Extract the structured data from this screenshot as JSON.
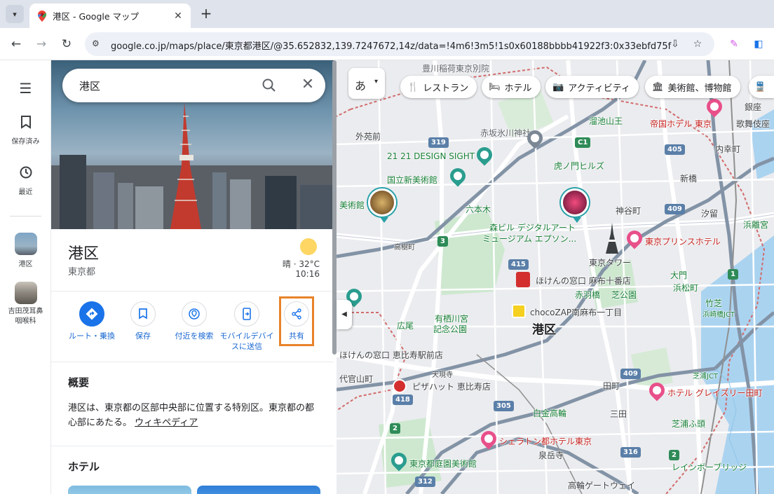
{
  "browser": {
    "tab_title": "港区 - Google マップ",
    "url": "google.co.jp/maps/place/東京都港区/@35.652832,139.7247672,14z/data=!4m6!3m5!1s0x60188bbbb41922f3:0x33ebfd75f2f0..."
  },
  "rail": {
    "saved": "保存済み",
    "recent": "最近",
    "place1": "港区",
    "place2": "吉田茂耳鼻咽喉科"
  },
  "search": {
    "query": "港区"
  },
  "place": {
    "name": "港区",
    "region": "東京都",
    "weather": "晴 · 32°C",
    "time": "10:16"
  },
  "actions": [
    {
      "label": "ルート・乗換"
    },
    {
      "label": "保存"
    },
    {
      "label": "付近を検索"
    },
    {
      "label": "モバイルデバイスに送信"
    },
    {
      "label": "共有"
    }
  ],
  "overview": {
    "heading": "概要",
    "text": "港区は、東京都の区部中央部に位置する特別区。東京都の都心部にあたる。",
    "link": "ウィキペディア"
  },
  "hotels": {
    "heading": "ホテル"
  },
  "map": {
    "lang_button": "あ",
    "chips": [
      "レストラン",
      "ホテル",
      "アクティビティ",
      "美術館、博物館"
    ],
    "labels": {
      "toyokawa": "豊川稲荷東京別院",
      "akasaka": "赤坂氷川神社",
      "gaienmae": "外苑前",
      "design": "21 21 DESIGN SIGHT",
      "nact": "国立新美術館",
      "toranomon": "虎ノ門ヒルズ",
      "roppongi": "六本木",
      "kamiyacho": "神谷町",
      "mori": "森ビル デジタルアート",
      "museum": "ミュージアム エプソン...",
      "tokyo_tower": "東京タワー",
      "tokyo_prince": "東京プリンスホテル",
      "hokennomadoguchi": "ほけんの窓口 麻布十番店",
      "shibakoen": "芝公園",
      "akabanebashi": "赤羽橋",
      "chocozap": "chocoZAP南麻布一丁目",
      "arisugawa": "有栖川宮",
      "arisugawa2": "記念公園",
      "hiroo": "広尾",
      "minato": "港区",
      "ebisu_store": "ほけんの窓口 恵比寿駅前店",
      "pizza": "ピザハット 恵比寿店",
      "daikanyama": "代官山町",
      "shirokane": "白金高輪",
      "sheraton": "シェラトン都ホテル東京",
      "teien": "東京都庭園美術館",
      "sengakuji": "泉岳寺",
      "teikoku": "帝国ホテル 東京",
      "uchisaiwai": "内幸町",
      "shinbashi": "新橋",
      "shiodome": "汐留",
      "hamamatsucho": "浜松町",
      "daimon": "大門",
      "takeshiba": "竹芝",
      "hamarikyu": "浜離宮",
      "tamachi": "田町",
      "intercity": "ホテル グレイスリー田町",
      "shibaura": "芝浦JCT",
      "hamazaki": "浜崎橋JCT",
      "shinagawa": "高輪ゲートウェイ",
      "rainbow": "レインボーブリッジ",
      "bijutsukan": "美術館",
      "takagicho": "高樹町",
      "tengencho": "天現寺",
      "shibakouen2": "芝公園",
      "mita": "三田",
      "tamei": "溜池山王",
      "ginza": "銀座",
      "kabukiza": "歌舞伎座",
      "shibaura2": "芝浦ふ頭"
    },
    "road_numbers": [
      "319",
      "C1",
      "405",
      "409",
      "3",
      "415",
      "418",
      "305",
      "2",
      "312",
      "409",
      "1",
      "316",
      "2"
    ]
  },
  "colors": {
    "accent": "#1a73e8",
    "highlight": "#e8832a",
    "park": "#c8e6c9",
    "water": "#aadaff"
  }
}
